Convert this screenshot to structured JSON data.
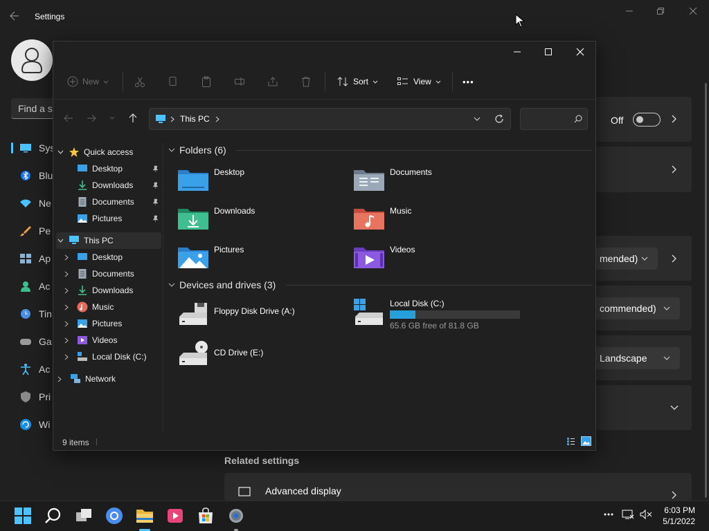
{
  "settings": {
    "title": "Settings",
    "find_placeholder": "Find a s",
    "nav": [
      "Sys",
      "Blu",
      "Ne",
      "Pe",
      "Ap",
      "Ac",
      "Tin",
      "Ga",
      "Ac",
      "Pri",
      "Wi"
    ],
    "toggle_label": "Off",
    "dropdown1": "mended)",
    "dropdown2": "commended)",
    "dropdown3": "Landscape",
    "related_settings": "Related settings",
    "advanced_display": "Advanced display"
  },
  "explorer": {
    "toolbar": {
      "new_label": "New",
      "sort_label": "Sort",
      "view_label": "View",
      "more_label": "•••"
    },
    "address": {
      "path": "This PC",
      "search_placeholder": ""
    },
    "nav": {
      "quick_access": "Quick access",
      "quick_items": [
        "Desktop",
        "Downloads",
        "Documents",
        "Pictures"
      ],
      "this_pc": "This PC",
      "pc_items": [
        "Desktop",
        "Documents",
        "Downloads",
        "Music",
        "Pictures",
        "Videos",
        "Local Disk (C:)"
      ],
      "network": "Network"
    },
    "folders_header": "Folders (6)",
    "folders": [
      "Desktop",
      "Documents",
      "Downloads",
      "Music",
      "Pictures",
      "Videos"
    ],
    "drives_header": "Devices and drives (3)",
    "drives": {
      "floppy": "Floppy Disk Drive (A:)",
      "local_name": "Local Disk (C:)",
      "local_free": "65.6 GB free of 81.8 GB",
      "local_used_fraction": 0.198,
      "cd": "CD Drive (E:)"
    },
    "status": "9 items"
  },
  "taskbar": {
    "time": "6:03 PM",
    "date": "5/1/2022"
  },
  "colors": {
    "accent": "#4cc2ff",
    "folder_blue": "#3aa0e8",
    "bg": "#202020"
  }
}
